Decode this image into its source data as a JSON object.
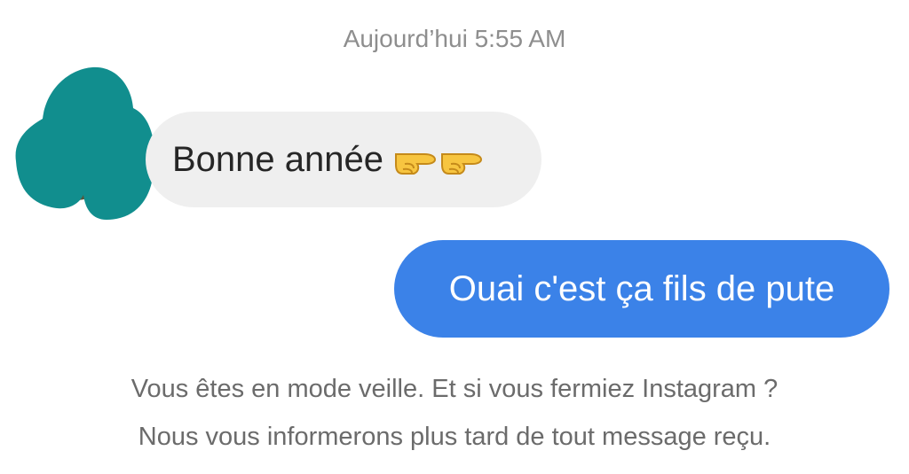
{
  "thread": {
    "timestamp": "Aujourd’hui 5:55 AM",
    "incoming_message": {
      "text": "Bonne année",
      "emoji": [
        "backhand-index-pointing-right",
        "backhand-index-pointing-right"
      ]
    },
    "outgoing_message": {
      "text": "Ouai c'est ça fils de pute"
    },
    "notice": {
      "line1": "Vous êtes en mode veille. Et si vous fermiez Instagram ?",
      "line2": "Nous vous informerons plus tard de tout message reçu."
    }
  },
  "colors": {
    "background": "#ffffff",
    "incoming_bubble": "#efefef",
    "outgoing_bubble": "#3b82e8",
    "avatar_scribble": "#118e8e",
    "muted_text": "#8e8e8e"
  }
}
